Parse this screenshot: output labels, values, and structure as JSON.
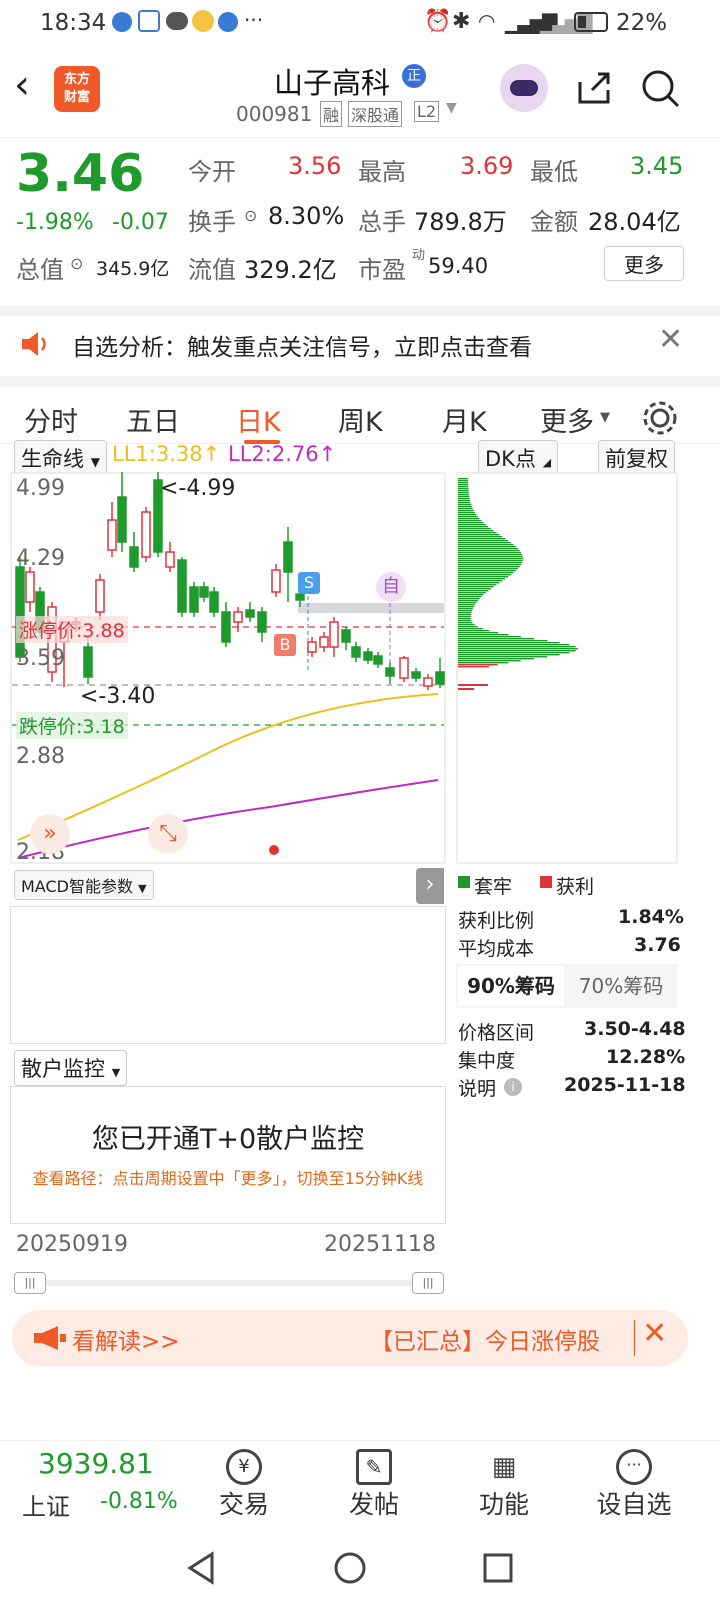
{
  "status_bar": {
    "time": "18:34",
    "battery": "22%",
    "icons": [
      "app-icon",
      "store-icon",
      "wechat-icon",
      "weather-icon",
      "app-icon",
      "more-icon",
      "alarm-icon",
      "bluetooth-icon",
      "wifi-icon",
      "signal-5g-icon",
      "signal-icon",
      "battery-icon"
    ]
  },
  "header": {
    "logo_text_1": "东方",
    "logo_text_2": "财富",
    "stock_name": "山子高科",
    "badge": "正",
    "code": "000981",
    "tags": [
      "融",
      "深股通",
      "L2"
    ]
  },
  "quote": {
    "price": "3.46",
    "change_pct": "-1.98%",
    "change": "-0.07",
    "open_label": "今开",
    "open": "3.56",
    "high_label": "最高",
    "high": "3.69",
    "low_label": "最低",
    "low": "3.45",
    "turnover_label": "换手",
    "turnover": "8.30%",
    "volume_label": "总手",
    "volume": "789.8万",
    "amount_label": "金额",
    "amount": "28.04亿",
    "mcap_label": "总值",
    "mcap": "345.9亿",
    "float_label": "流值",
    "float": "329.2亿",
    "pe_label": "市盈",
    "pe_sup": "动",
    "pe": "59.40",
    "more": "更多"
  },
  "notice": {
    "text": "自选分析：触发重点关注信号，立即点击查看"
  },
  "tabs": {
    "items": [
      "分时",
      "五日",
      "日K",
      "周K",
      "月K",
      "更多"
    ],
    "active": 2
  },
  "chart": {
    "indicator_select": "生命线",
    "ll1": "LL1:3.38↑",
    "ll2": "LL2:2.76↑",
    "dk_select": "DK点",
    "fuquan": "前复权",
    "ylabels": [
      "4.99",
      "4.29",
      "3.59",
      "2.88",
      "2.18"
    ],
    "high_annot": "<-4.99",
    "low_annot": "<-3.40",
    "limit_up": "涨停价:3.88",
    "limit_down": "跌停价:3.18",
    "sig_s": "S",
    "sig_b": "B",
    "sig_zi": "自",
    "macd_select": "MACD智能参数",
    "retail_select": "散户监控",
    "retail_title": "您已开通T+0散户监控",
    "retail_path": "查看路径：点击周期设置中「更多」，切换至15分钟K线",
    "date_start": "20250919",
    "date_end": "20251118",
    "colors": {
      "up": "#e0333a",
      "down": "#1f9a2c",
      "ll1": "#e8c21a",
      "ll2": "#c02bc5"
    }
  },
  "chips": {
    "legend_trap": "套牢",
    "legend_profit": "获利",
    "rows": [
      {
        "label": "获利比例",
        "value": "1.84%"
      },
      {
        "label": "平均成本",
        "value": "3.76"
      }
    ],
    "tab_90": "90%筹码",
    "tab_70": "70%筹码",
    "rows2": [
      {
        "label": "价格区间",
        "value": "3.50-4.48"
      },
      {
        "label": "集中度",
        "value": "12.28%"
      },
      {
        "label": "说明",
        "value": "2025-11-18"
      }
    ]
  },
  "banner": {
    "text_left": "看解读>>",
    "text_right": "【已汇总】今日涨停股"
  },
  "bottom": {
    "index_value": "3939.81",
    "index_name": "上证",
    "index_change": "-0.81%",
    "items": [
      "交易",
      "发帖",
      "功能",
      "设自选"
    ]
  }
}
